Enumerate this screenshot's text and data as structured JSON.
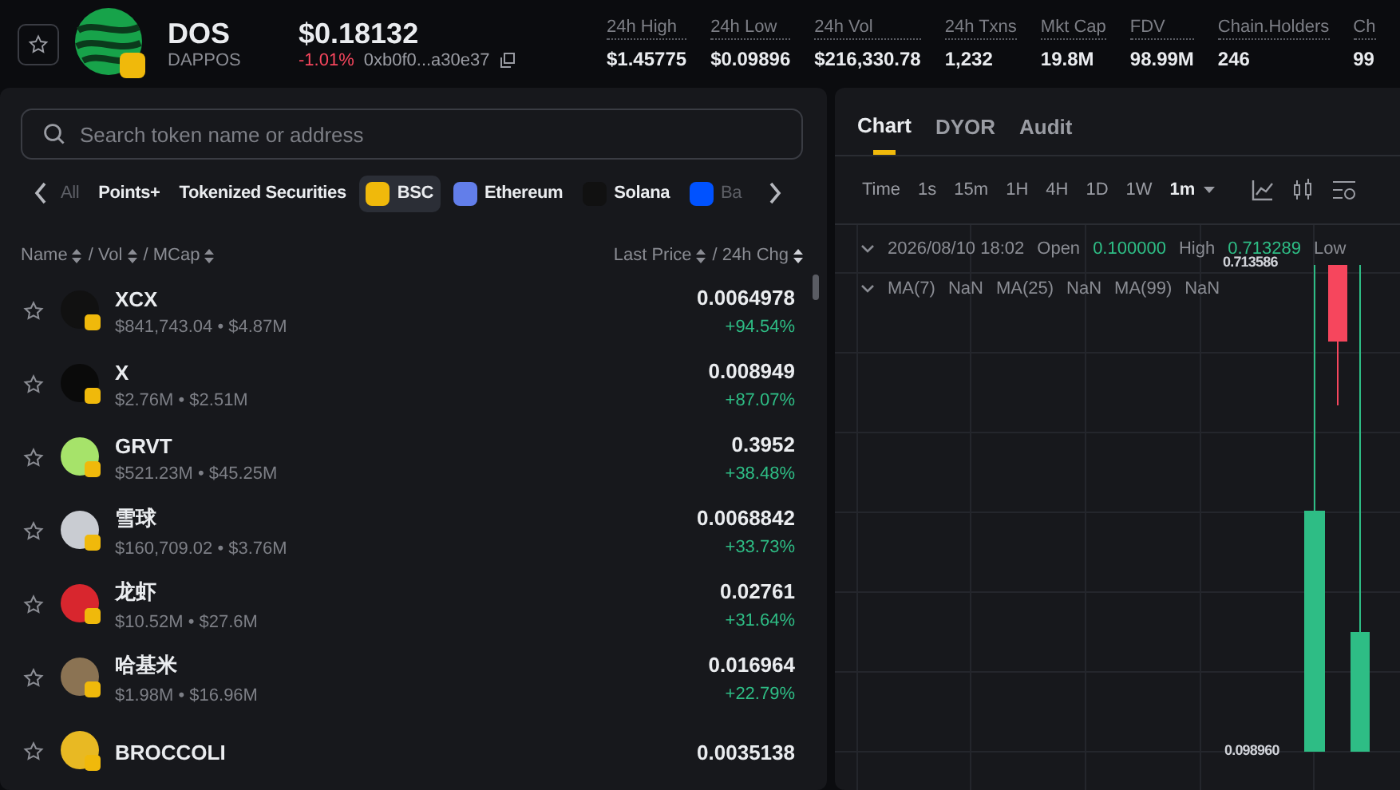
{
  "token": {
    "symbol": "DOS",
    "name": "DAPPOS",
    "price": "$0.18132",
    "change": "-1.01%",
    "address": "0xb0f0...a30e37",
    "favorite": false
  },
  "stats": [
    {
      "label": "24h High",
      "value": "$1.45775"
    },
    {
      "label": "24h Low",
      "value": "$0.09896"
    },
    {
      "label": "24h Vol",
      "value": "$216,330.78"
    },
    {
      "label": "24h Txns",
      "value": "1,232"
    },
    {
      "label": "Mkt Cap",
      "value": "19.8M"
    },
    {
      "label": "FDV",
      "value": "98.99M"
    },
    {
      "label": "Chain.Holders",
      "value": "246"
    },
    {
      "label": "Ch",
      "value": "99"
    }
  ],
  "search": {
    "placeholder": "Search token name or address"
  },
  "chain_tabs": [
    {
      "label": "All",
      "kind": "text",
      "selected": false
    },
    {
      "label": "Points+",
      "kind": "text",
      "selected": false
    },
    {
      "label": "Tokenized Securities",
      "kind": "text",
      "selected": false
    },
    {
      "label": "BSC",
      "kind": "bsc",
      "selected": true
    },
    {
      "label": "Ethereum",
      "kind": "ethereum",
      "selected": false
    },
    {
      "label": "Solana",
      "kind": "solana",
      "selected": false
    },
    {
      "label": "Ba",
      "kind": "base",
      "selected": false
    }
  ],
  "list_header": {
    "left": [
      "Name",
      "/ Vol",
      "/ MCap"
    ],
    "right": [
      "Last Price",
      "/ 24h Chg"
    ]
  },
  "tokens": [
    {
      "name": "XCX",
      "vol_mcap": "$841,743.04 • $4.87M",
      "price": "0.0064978",
      "change": "+94.54%",
      "color": "#111111"
    },
    {
      "name": "X",
      "vol_mcap": "$2.76M • $2.51M",
      "price": "0.008949",
      "change": "+87.07%",
      "color": "#0a0a0a"
    },
    {
      "name": "GRVT",
      "vol_mcap": "$521.23M • $45.25M",
      "price": "0.3952",
      "change": "+38.48%",
      "color": "#a6e36a"
    },
    {
      "name": "雪球",
      "vol_mcap": "$160,709.02 • $3.76M",
      "price": "0.0068842",
      "change": "+33.73%",
      "color": "#c9ccd2"
    },
    {
      "name": "龙虾",
      "vol_mcap": "$10.52M • $27.6M",
      "price": "0.02761",
      "change": "+31.64%",
      "color": "#d8262e"
    },
    {
      "name": "哈基米",
      "vol_mcap": "$1.98M • $16.96M",
      "price": "0.016964",
      "change": "+22.79%",
      "color": "#8b7353"
    },
    {
      "name": "BROCCOLI",
      "price": "0.0035138",
      "color": "#e8b923"
    }
  ],
  "chart_tabs": [
    {
      "label": "Chart",
      "selected": true
    },
    {
      "label": "DYOR",
      "selected": false
    },
    {
      "label": "Audit",
      "selected": false
    }
  ],
  "timeframes": [
    {
      "label": "Time",
      "selected": false
    },
    {
      "label": "1s",
      "selected": false
    },
    {
      "label": "15m",
      "selected": false
    },
    {
      "label": "1H",
      "selected": false
    },
    {
      "label": "4H",
      "selected": false
    },
    {
      "label": "1D",
      "selected": false
    },
    {
      "label": "1W",
      "selected": false
    },
    {
      "label": "1m",
      "selected": true
    }
  ],
  "ohlc": {
    "time": "2026/08/10 18:02",
    "items": [
      {
        "label": "Open",
        "value": "0.100000"
      },
      {
        "label": "High",
        "value": "0.713289"
      },
      {
        "label": "Low"
      }
    ]
  },
  "ma": [
    {
      "label": "MA(7)",
      "value": "NaN"
    },
    {
      "label": "MA(25)",
      "value": "NaN"
    },
    {
      "label": "MA(99)",
      "value": "NaN"
    }
  ],
  "price_marks": {
    "high": "0.713586",
    "low": "0.098960"
  }
}
